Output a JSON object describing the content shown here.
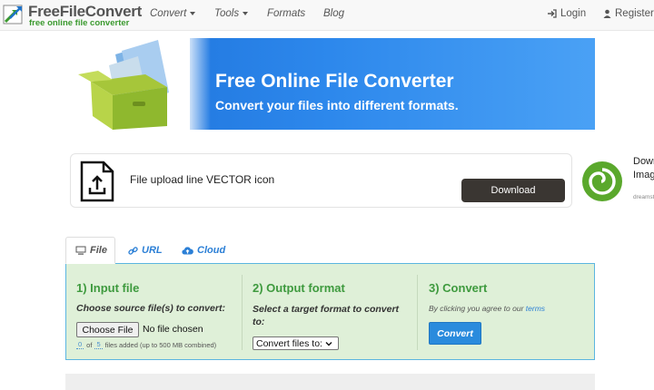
{
  "brand": {
    "title": "FreeFileConvert",
    "tagline": "free online file converter"
  },
  "nav": {
    "items": [
      {
        "label": "Convert",
        "dropdown": true
      },
      {
        "label": "Tools",
        "dropdown": true
      },
      {
        "label": "Formats",
        "dropdown": false
      },
      {
        "label": "Blog",
        "dropdown": false
      }
    ],
    "login": "Login",
    "register": "Register"
  },
  "banner": {
    "title": "Free Online File Converter",
    "subtitle": "Convert your files into different formats."
  },
  "ad": {
    "text": "File upload line VECTOR icon",
    "button": "Download",
    "side_line1": "Down",
    "side_line2": "Imag",
    "side_line3": "dreamst"
  },
  "tabs": [
    {
      "label": "File",
      "icon": "monitor-icon",
      "active": true
    },
    {
      "label": "URL",
      "icon": "link-icon",
      "active": false
    },
    {
      "label": "Cloud",
      "icon": "cloud-upload-icon",
      "active": false
    }
  ],
  "converter": {
    "step1": {
      "title": "1) Input file",
      "desc": "Choose source file(s) to convert:",
      "choose_button": "Choose File",
      "no_file": "No file chosen",
      "files_added": "0",
      "files_max": "5",
      "of_label": "of",
      "limit_text": "files added (up to 500 MB combined)"
    },
    "step2": {
      "title": "2) Output format",
      "desc": "Select a target format to convert to:",
      "select_value": "Convert files to:"
    },
    "step3": {
      "title": "3) Convert",
      "agree_text": "By clicking you agree to our",
      "terms_link": "terms",
      "button": "Convert"
    }
  },
  "colors": {
    "accent_blue": "#2a8bdd",
    "panel_green": "#dff0d8",
    "step_title_green": "#3e9a3e",
    "banner_blue": "#2d88ec"
  }
}
